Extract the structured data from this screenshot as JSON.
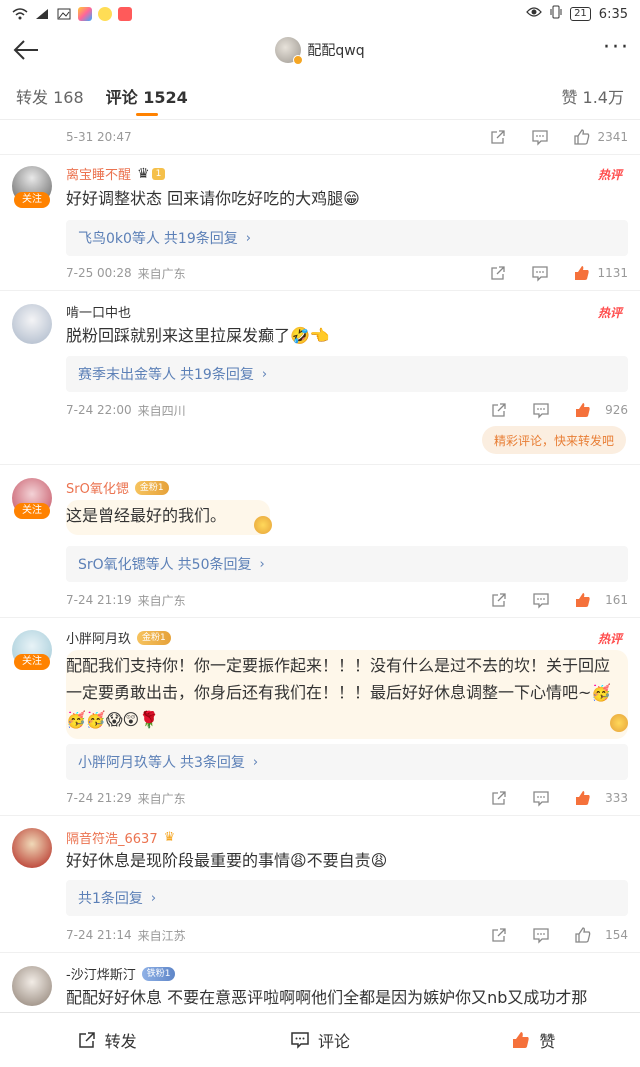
{
  "status_bar": {
    "time": "6:35",
    "battery": "21"
  },
  "header": {
    "account_name": "配配qwq"
  },
  "tabs": {
    "reposts": "转发 168",
    "comments": "评论 1524",
    "likes": "赞 1.4万"
  },
  "top_meta": {
    "time": "5-31 20:47",
    "like_count": "2341"
  },
  "comments": [
    {
      "username": "离宝睡不醒",
      "level": "1",
      "follow_label": "关注",
      "hot": "热评",
      "text": "好好调整状态 回来请你吃好吃的大鸡腿😁",
      "reply_users": "飞鸟0k0等人",
      "reply_count": "共19条回复",
      "time": "7-25 00:28",
      "location": "来自广东",
      "likes": "1131"
    },
    {
      "username": "啃一口中也",
      "hot": "热评",
      "text": "脱粉回踩就别来这里拉屎发癫了🤣👈",
      "reply_users": "赛季末出金等人",
      "reply_count": "共19条回复",
      "time": "7-24 22:00",
      "location": "来自四川",
      "likes": "926",
      "share_prompt": "精彩评论，快来转发吧"
    },
    {
      "username": "SrO氧化锶",
      "fan_badge": "金粉1",
      "follow_label": "关注",
      "text": "这是曾经最好的我们。",
      "reply_users": "SrO氧化锶等人",
      "reply_count": "共50条回复",
      "time": "7-24 21:19",
      "location": "来自广东",
      "likes": "161"
    },
    {
      "username": "小胖阿月玖",
      "fan_badge": "金粉1",
      "follow_label": "关注",
      "hot": "热评",
      "text": "配配我们支持你！你一定要振作起来！！！没有什么是过不去的坎！关于回应一定要勇敢出击，你身后还有我们在！！！最后好好休息调整一下心情吧~🥳🥳🥳😱😲🌹",
      "reply_users": "小胖阿月玖等人",
      "reply_count": "共3条回复",
      "time": "7-24 21:29",
      "location": "来自广东",
      "likes": "333"
    },
    {
      "username": "隔音符浩_6637",
      "text": "好好休息是现阶段最重要的事情😩不要自责😩",
      "reply_count": "共1条回复",
      "time": "7-24 21:14",
      "location": "来自江苏",
      "likes": "154"
    },
    {
      "username": "-沙汀烨斯汀",
      "fan_badge": "铁粉1",
      "text": "配配好好休息 不要在意恶评啦啊啊他们全都是因为嫉妒你又nb又成功才那"
    }
  ],
  "bottom_bar": {
    "repost": "转发",
    "comment": "评论",
    "like": "赞"
  },
  "colors": {
    "accent": "#ff8200",
    "link": "#5c80b7",
    "hot": "#ff4d4d"
  }
}
